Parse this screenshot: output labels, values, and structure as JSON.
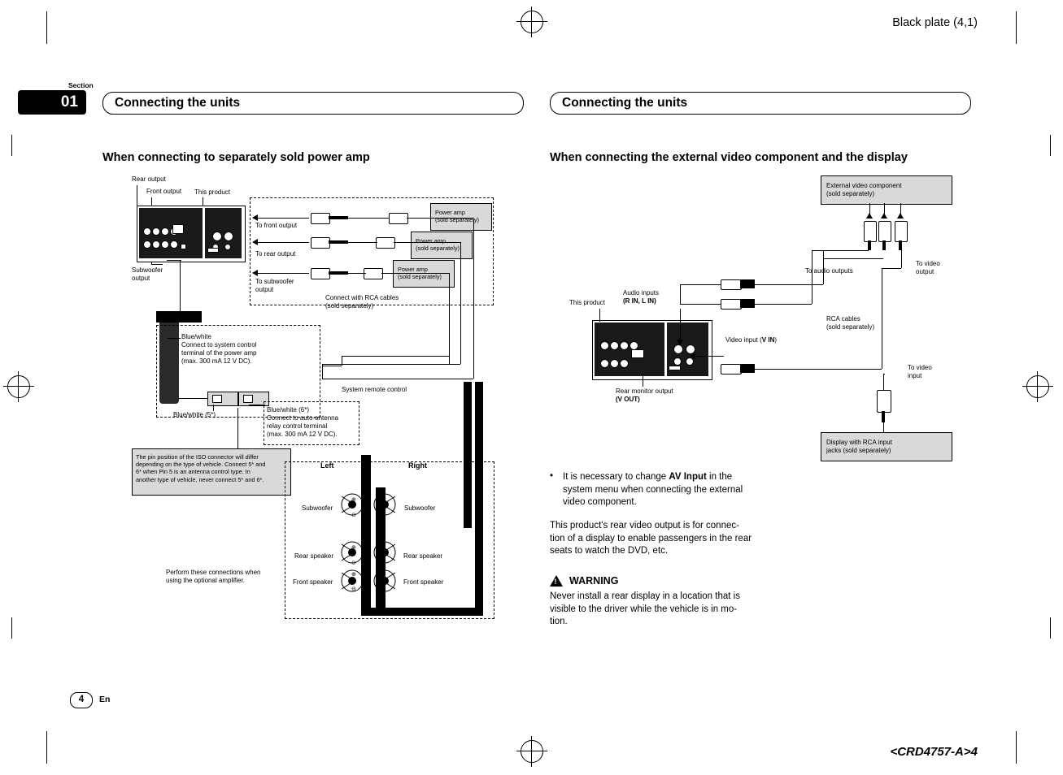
{
  "page": {
    "black_plate": "Black plate (4,1)",
    "crd_code": "<CRD4757-A>4",
    "section_label": "Section",
    "section_number": "01",
    "page_number": "4",
    "language": "En"
  },
  "left_column": {
    "chapter_title": "Connecting the units",
    "heading": "When connecting to separately sold power amp",
    "labels": {
      "rear_output": "Rear output",
      "front_output": "Front output",
      "this_product": "This product",
      "subwoofer_output": "Subwoofer\noutput",
      "to_front_output": "To front output",
      "to_rear_output": "To rear output",
      "to_subwoofer_output": "To subwoofer\noutput",
      "power_amp_1": "Power amp\n(sold separately)",
      "power_amp_2": "Power amp\n(sold separately)",
      "power_amp_3": "Power amp\n(sold separately)",
      "connect_rca": "Connect with RCA cables\n(sold separately)",
      "blue_white_system": "Blue/white\nConnect to system control\nterminal of the power amp\n(max. 300 mA 12 V DC).",
      "blue_white_5": "Blue/white (5*)",
      "blue_white_6": "Blue/white (6*)\nConnect to auto-antenna\nrelay control terminal\n(max. 300 mA 12 V DC).",
      "system_remote_control": "System remote control",
      "iso_note": "The pin position of the ISO connector will differ\ndepending on the type of vehicle. Connect 5* and\n6* when Pin 5 is an antenna control type. In\nanother type of vehicle, never connect 5* and 6*.",
      "left": "Left",
      "right": "Right",
      "subwoofer_l": "Subwoofer",
      "subwoofer_r": "Subwoofer",
      "rear_speaker_l": "Rear speaker",
      "rear_speaker_r": "Rear speaker",
      "front_speaker_l": "Front speaker",
      "front_speaker_r": "Front speaker",
      "optional_amp_note": "Perform these connections when\nusing the optional amplifier."
    }
  },
  "right_column": {
    "chapter_title": "Connecting the units",
    "heading": "When connecting the external video component and the display",
    "labels": {
      "external_video_component": "External video component\n(sold separately)",
      "to_audio_outputs": "To audio outputs",
      "to_video_output": "To video\noutput",
      "this_product": "This product",
      "audio_inputs": "Audio inputs",
      "audio_inputs_bold": "(R IN, L IN)",
      "rca_cables": "RCA cables\n(sold separately)",
      "video_input": "Video input (",
      "video_input_bold": "V IN",
      "video_input_end": ")",
      "rear_monitor_output": "Rear monitor output",
      "rear_monitor_output_bold": "(V OUT)",
      "to_video_input": "To video\ninput",
      "display_rca": "Display with RCA input\njacks (sold separately)"
    },
    "body": {
      "bullet_marker": "•",
      "bullet_text_1": "It is necessary to change ",
      "bullet_text_bold": "AV Input",
      "bullet_text_2": " in the system menu when connecting the external video component.",
      "paragraph": "This product's rear video output is for connec-\ntion of a display to enable passengers in the rear\nseats to watch the DVD, etc.",
      "warning_title": "WARNING",
      "warning_text": "Never install a rear display in a location that is\nvisible to the driver while the vehicle is in mo-\ntion."
    }
  }
}
